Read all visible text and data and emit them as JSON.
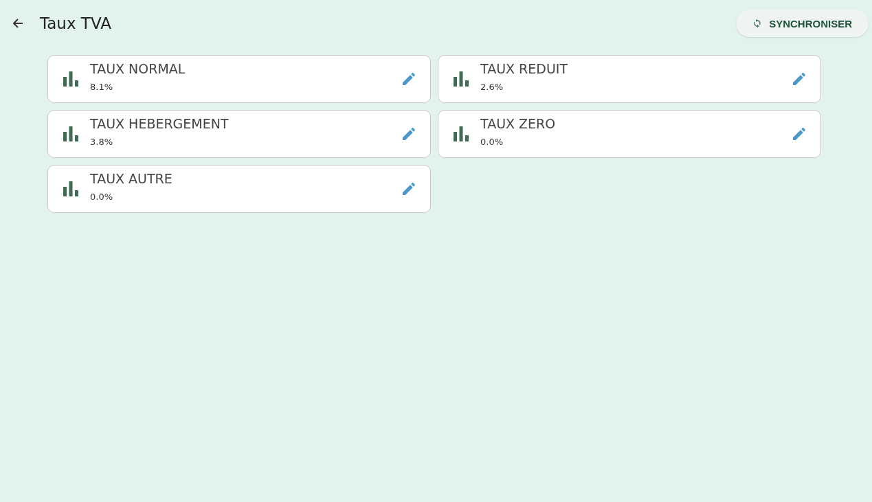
{
  "header": {
    "title": "Taux TVA",
    "sync_button": "SYNCHRONISER"
  },
  "rates": [
    {
      "name": "TAUX NORMAL",
      "value": "8.1%"
    },
    {
      "name": "TAUX REDUIT",
      "value": "2.6%"
    },
    {
      "name": "TAUX HEBERGEMENT",
      "value": "3.8%"
    },
    {
      "name": "TAUX ZERO",
      "value": "0.0%"
    },
    {
      "name": "TAUX AUTRE",
      "value": "0.0%"
    }
  ]
}
